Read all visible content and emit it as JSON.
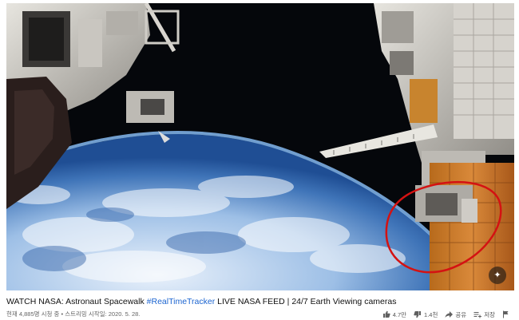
{
  "video": {
    "watermark_icon": "nasa-avatar-icon"
  },
  "title": {
    "prefix": "WATCH NASA: Astronaut Spacewalk ",
    "hashtag": "#RealTimeTracker",
    "suffix": " LIVE NASA FEED | 24/7 Earth Viewing cameras"
  },
  "meta": {
    "text": "현재 4,885명 시청 중 • 스트리밍 시작일: 2020. 5. 28."
  },
  "actions": {
    "like_count": "4.7만",
    "dislike_count": "1.4천",
    "share_label": "공유",
    "save_label": "저장"
  },
  "colors": {
    "annotation_circle": "#d41212",
    "hashtag": "#1b64d0"
  }
}
